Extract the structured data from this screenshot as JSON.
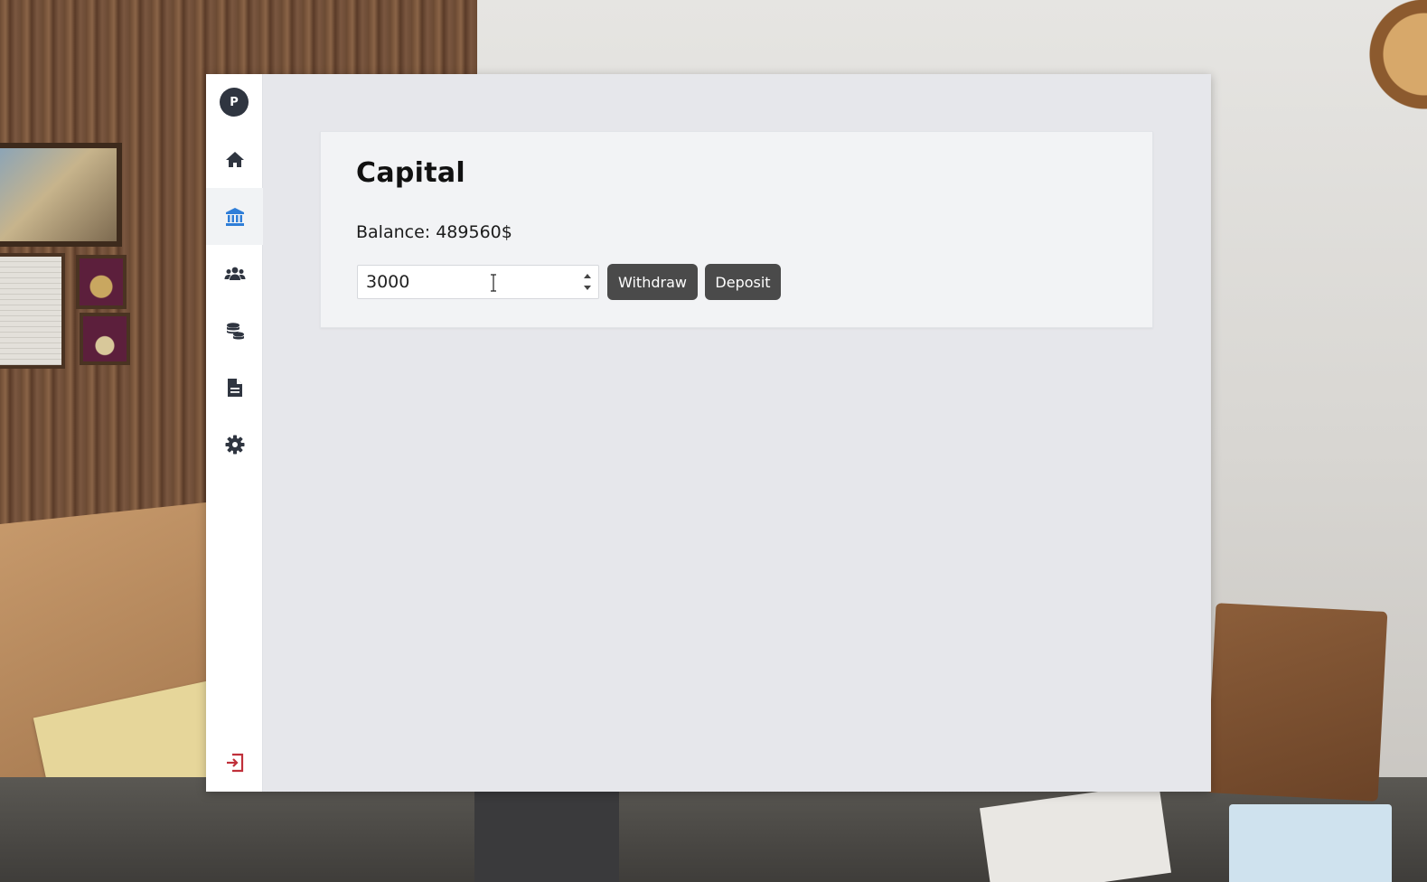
{
  "sidebar": {
    "avatar_initial": "P",
    "items": [
      {
        "name": "home",
        "icon": "home-icon",
        "active": false
      },
      {
        "name": "bank",
        "icon": "bank-icon",
        "active": true
      },
      {
        "name": "employees",
        "icon": "users-icon",
        "active": false
      },
      {
        "name": "finance",
        "icon": "coins-icon",
        "active": false
      },
      {
        "name": "documents",
        "icon": "document-icon",
        "active": false
      },
      {
        "name": "settings",
        "icon": "gear-icon",
        "active": false
      }
    ],
    "logout_icon": "logout-icon"
  },
  "capital": {
    "title": "Capital",
    "balance_label": "Balance: ",
    "balance_value": "489560$",
    "amount_value": "3000",
    "withdraw_label": "Withdraw",
    "deposit_label": "Deposit"
  },
  "colors": {
    "accent": "#2f7ed8",
    "logout": "#c0303a",
    "button_bg": "#4a4a4a",
    "panel_bg": "#e6e7eb",
    "card_bg": "#f2f3f5",
    "icon_default": "#2f3540"
  }
}
